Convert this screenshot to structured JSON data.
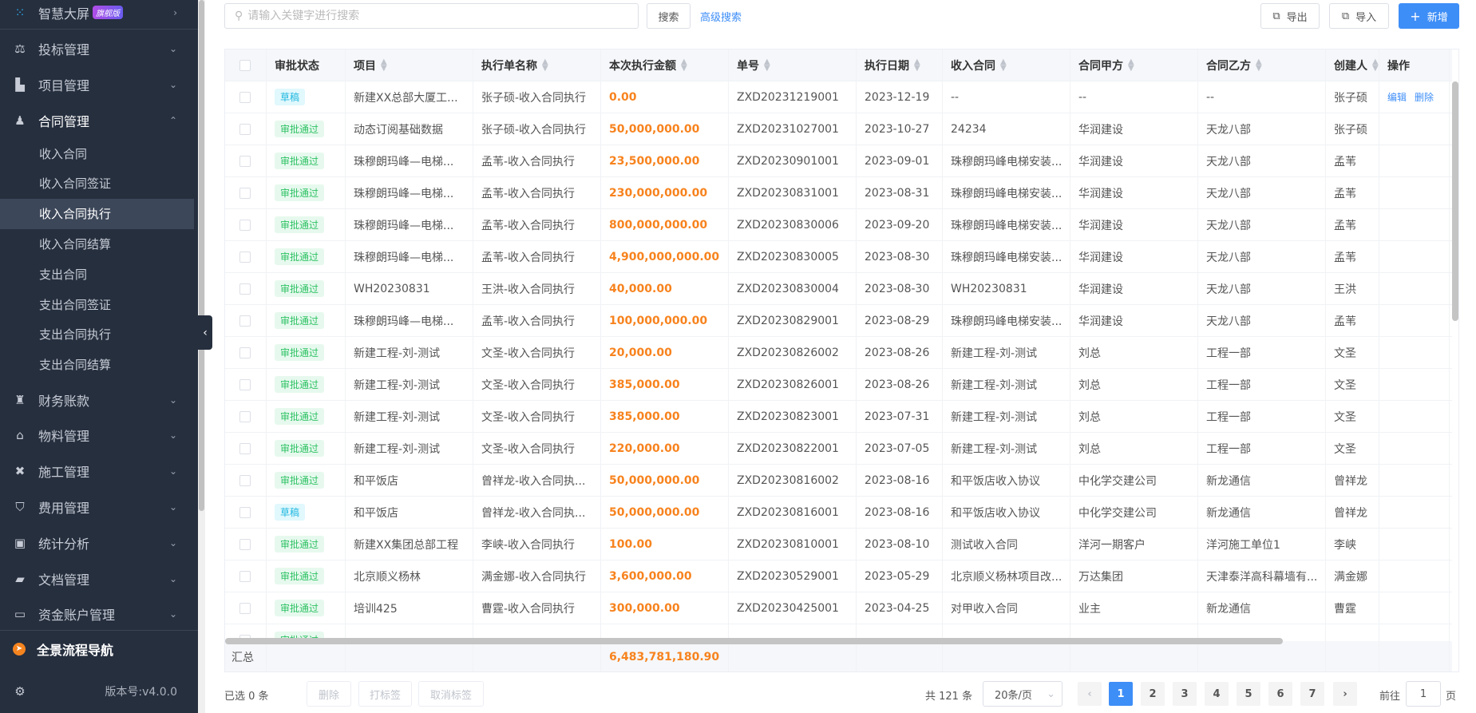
{
  "sidebar": {
    "top": {
      "label": "智慧大屏",
      "badge": "旗舰版"
    },
    "groups": [
      {
        "label": "投标管理",
        "icon": "gavel-icon",
        "glyph": "⚖"
      },
      {
        "label": "项目管理",
        "icon": "building-icon",
        "glyph": "▙"
      },
      {
        "label": "合同管理",
        "icon": "user-icon",
        "glyph": "♟",
        "open": true
      }
    ],
    "contract_items": [
      "收入合同",
      "收入合同签证",
      "收入合同执行",
      "收入合同结算",
      "支出合同",
      "支出合同签证",
      "支出合同执行",
      "支出合同结算"
    ],
    "active_item": "收入合同执行",
    "groups_after": [
      {
        "label": "财务账款",
        "icon": "money-bag-icon",
        "glyph": "♜"
      },
      {
        "label": "物料管理",
        "icon": "warehouse-icon",
        "glyph": "⌂"
      },
      {
        "label": "施工管理",
        "icon": "tools-icon",
        "glyph": "✖"
      },
      {
        "label": "费用管理",
        "icon": "shield-icon",
        "glyph": "⛉"
      },
      {
        "label": "统计分析",
        "icon": "chart-icon",
        "glyph": "▣"
      },
      {
        "label": "文档管理",
        "icon": "folder-icon",
        "glyph": "▰"
      },
      {
        "label": "资金账户管理",
        "icon": "card-icon",
        "glyph": "▭"
      }
    ],
    "navigator": "全景流程导航",
    "version": "版本号:v4.0.0"
  },
  "toolbar": {
    "search_placeholder": "请输入关键字进行搜索",
    "search_label": "搜索",
    "advanced_label": "高级搜索",
    "export_label": "导出",
    "import_label": "导入",
    "add_label": "新增"
  },
  "colors": {
    "accent": "#3e8ef7",
    "amount": "#f7831e",
    "approved": "#2ec264",
    "draft": "#22b8e0",
    "sidebar": "#262f3e"
  },
  "table": {
    "columns": [
      "审批状态",
      "项目",
      "执行单名称",
      "本次执行金额",
      "单号",
      "执行日期",
      "收入合同",
      "合同甲方",
      "合同乙方",
      "创建人",
      "操作"
    ],
    "sortable": [
      false,
      true,
      true,
      true,
      true,
      true,
      true,
      true,
      true,
      true,
      false
    ],
    "rows": [
      [
        "草稿",
        "新建XX总部大厦工...",
        "张子硕-收入合同执行",
        "0.00",
        "ZXD20231219001",
        "2023-12-19",
        "--",
        "--",
        "--",
        "张子硕"
      ],
      [
        "审批通过",
        "动态订阅基础数据",
        "张子硕-收入合同执行",
        "50,000,000.00",
        "ZXD20231027001",
        "2023-10-27",
        "24234",
        "华润建设",
        "天龙八部",
        "张子硕"
      ],
      [
        "审批通过",
        "珠穆朗玛峰—电梯...",
        "孟苇-收入合同执行",
        "23,500,000.00",
        "ZXD20230901001",
        "2023-09-01",
        "珠穆朗玛峰电梯安装...",
        "华润建设",
        "天龙八部",
        "孟苇"
      ],
      [
        "审批通过",
        "珠穆朗玛峰—电梯...",
        "孟苇-收入合同执行",
        "230,000,000.00",
        "ZXD20230831001",
        "2023-08-31",
        "珠穆朗玛峰电梯安装...",
        "华润建设",
        "天龙八部",
        "孟苇"
      ],
      [
        "审批通过",
        "珠穆朗玛峰—电梯...",
        "孟苇-收入合同执行",
        "800,000,000.00",
        "ZXD20230830006",
        "2023-09-20",
        "珠穆朗玛峰电梯安装...",
        "华润建设",
        "天龙八部",
        "孟苇"
      ],
      [
        "审批通过",
        "珠穆朗玛峰—电梯...",
        "孟苇-收入合同执行",
        "4,900,000,000.00",
        "ZXD20230830005",
        "2023-08-30",
        "珠穆朗玛峰电梯安装...",
        "华润建设",
        "天龙八部",
        "孟苇"
      ],
      [
        "审批通过",
        "WH20230831",
        "王洪-收入合同执行",
        "40,000.00",
        "ZXD20230830004",
        "2023-08-30",
        "WH20230831",
        "华润建设",
        "天龙八部",
        "王洪"
      ],
      [
        "审批通过",
        "珠穆朗玛峰—电梯...",
        "孟苇-收入合同执行",
        "100,000,000.00",
        "ZXD20230829001",
        "2023-08-29",
        "珠穆朗玛峰电梯安装...",
        "华润建设",
        "天龙八部",
        "孟苇"
      ],
      [
        "审批通过",
        "新建工程-刘-测试",
        "文圣-收入合同执行",
        "20,000.00",
        "ZXD20230826002",
        "2023-08-26",
        "新建工程-刘-测试",
        "刘总",
        "工程一部",
        "文圣"
      ],
      [
        "审批通过",
        "新建工程-刘-测试",
        "文圣-收入合同执行",
        "385,000.00",
        "ZXD20230826001",
        "2023-08-26",
        "新建工程-刘-测试",
        "刘总",
        "工程一部",
        "文圣"
      ],
      [
        "审批通过",
        "新建工程-刘-测试",
        "文圣-收入合同执行",
        "385,000.00",
        "ZXD20230823001",
        "2023-07-31",
        "新建工程-刘-测试",
        "刘总",
        "工程一部",
        "文圣"
      ],
      [
        "审批通过",
        "新建工程-刘-测试",
        "文圣-收入合同执行",
        "220,000.00",
        "ZXD20230822001",
        "2023-07-05",
        "新建工程-刘-测试",
        "刘总",
        "工程一部",
        "文圣"
      ],
      [
        "审批通过",
        "和平饭店",
        "曾祥龙-收入合同执...",
        "50,000,000.00",
        "ZXD20230816002",
        "2023-08-16",
        "和平饭店收入协议",
        "中化学交建公司",
        "新龙通信",
        "曾祥龙"
      ],
      [
        "草稿",
        "和平饭店",
        "曾祥龙-收入合同执...",
        "50,000,000.00",
        "ZXD20230816001",
        "2023-08-16",
        "和平饭店收入协议",
        "中化学交建公司",
        "新龙通信",
        "曾祥龙"
      ],
      [
        "审批通过",
        "新建XX集团总部工程",
        "李峡-收入合同执行",
        "100.00",
        "ZXD20230810001",
        "2023-08-10",
        "测试收入合同",
        "洋河一期客户",
        "洋河施工单位1",
        "李峡"
      ],
      [
        "审批通过",
        "北京顺义杨林",
        "满金娜-收入合同执行",
        "3,600,000.00",
        "ZXD20230529001",
        "2023-05-29",
        "北京顺义杨林项目改...",
        "万达集团",
        "天津泰洋高科幕墙有...",
        "满金娜"
      ],
      [
        "审批通过",
        "培训425",
        "曹霆-收入合同执行",
        "300,000.00",
        "ZXD20230425001",
        "2023-04-25",
        "对甲收入合同",
        "业主",
        "新龙通信",
        "曹霆"
      ],
      [
        "审批通过",
        "",
        "",
        "",
        "",
        "",
        "",
        "",
        "",
        ""
      ]
    ],
    "row_actions": [
      "编辑",
      "删除"
    ],
    "summary_label": "汇总",
    "summary_amount": "6,483,781,180.90"
  },
  "footer": {
    "selected": "已选 0 条",
    "delete": "删除",
    "tag": "打标签",
    "untag": "取消标签",
    "total": "共 121 条",
    "page_size": "20条/页",
    "pages": [
      "1",
      "2",
      "3",
      "4",
      "5",
      "6",
      "7"
    ],
    "current_page": "1",
    "goto_label": "前往",
    "goto_value": "1",
    "page_unit": "页"
  }
}
